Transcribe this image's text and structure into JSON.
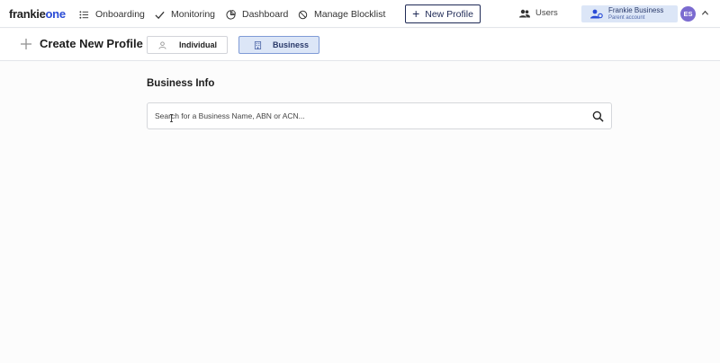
{
  "brand": {
    "name_part1": "frankie",
    "name_part2": "one",
    "accent": "#2a4bd6"
  },
  "nav": [
    {
      "label": "Onboarding",
      "icon": "list-icon"
    },
    {
      "label": "Monitoring",
      "icon": "check-icon"
    },
    {
      "label": "Dashboard",
      "icon": "chart-icon"
    },
    {
      "label": "Manage Blocklist",
      "icon": "block-icon"
    }
  ],
  "new_profile_button": {
    "label": "New Profile",
    "icon": "plus-icon"
  },
  "users": {
    "label": "Users",
    "icon": "users-icon"
  },
  "account": {
    "name": "Frankie Business",
    "subtitle": "Parent account",
    "icon": "user-gear-icon"
  },
  "avatar": {
    "initials": "ES",
    "color": "#7b6bd0"
  },
  "page": {
    "title": "Create New Profile",
    "title_icon": "plus-icon"
  },
  "profile_types": [
    {
      "label": "Individual",
      "icon": "person-icon",
      "selected": false
    },
    {
      "label": "Business",
      "icon": "building-icon",
      "selected": true
    }
  ],
  "business_info": {
    "heading": "Business Info",
    "search_placeholder": "Search for a Business Name, ABN or ACN...",
    "search_value": ""
  }
}
